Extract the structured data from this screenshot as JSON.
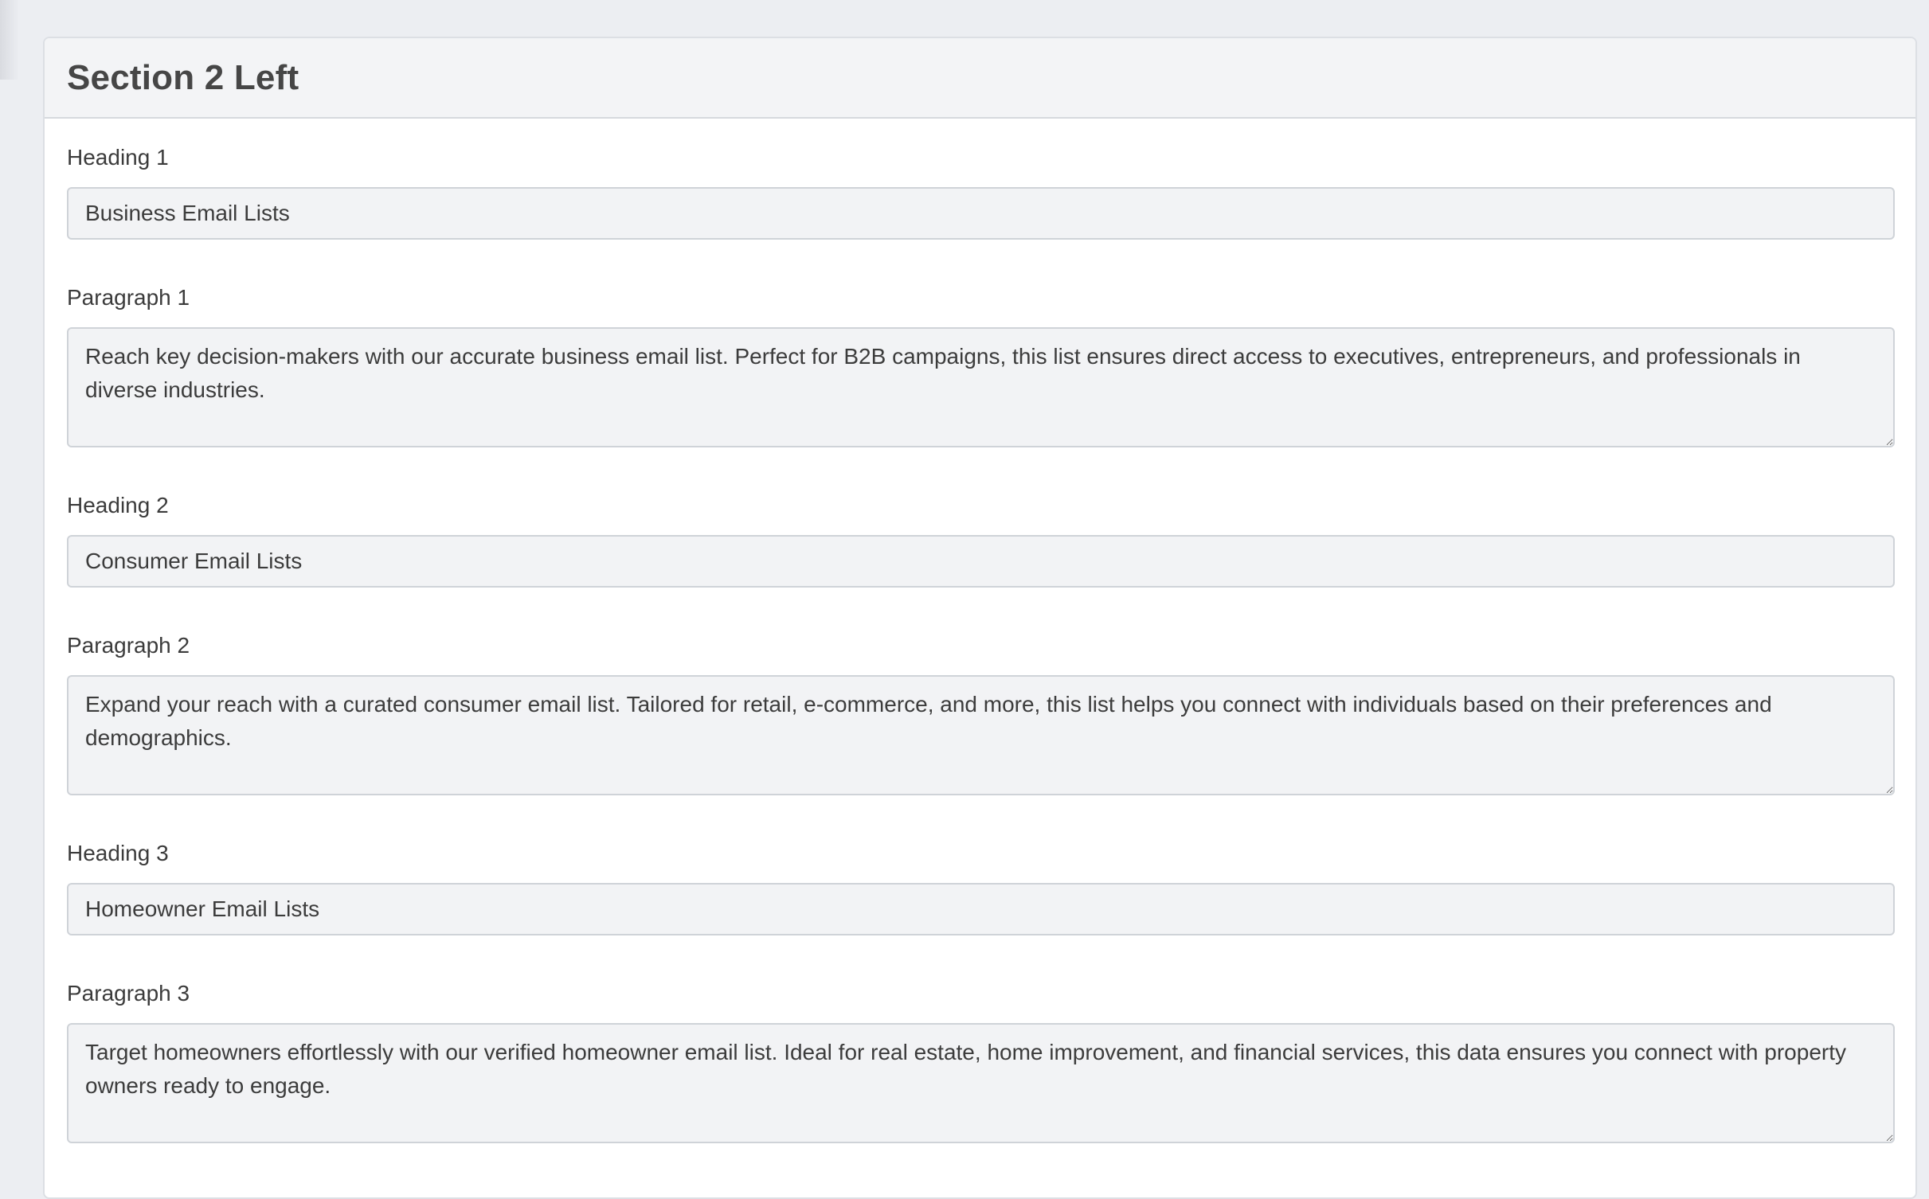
{
  "section": {
    "title": "Section 2 Left"
  },
  "fields": [
    {
      "label": "Heading 1",
      "value": "Business Email Lists"
    },
    {
      "label": "Paragraph 1",
      "value": "Reach key decision-makers with our accurate business email list. Perfect for B2B campaigns, this list ensures direct access to executives, entrepreneurs, and professionals in diverse industries."
    },
    {
      "label": "Heading 2",
      "value": "Consumer Email Lists"
    },
    {
      "label": "Paragraph 2",
      "value": "Expand your reach with a curated consumer email list. Tailored for retail, e-commerce, and more, this list helps you connect with individuals based on their preferences and demographics."
    },
    {
      "label": "Heading 3",
      "value": "Homeowner Email Lists"
    },
    {
      "label": "Paragraph 3",
      "value": "Target homeowners effortlessly with our verified homeowner email list. Ideal for real estate, home improvement, and financial services, this data ensures you connect with property owners ready to engage."
    }
  ]
}
